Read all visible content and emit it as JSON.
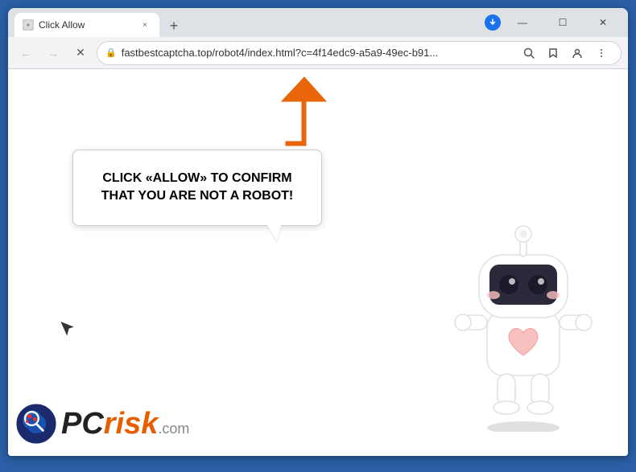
{
  "browser": {
    "title": "Click Allow",
    "tab": {
      "title": "Click Allow",
      "close_label": "×"
    },
    "new_tab_label": "+",
    "window_controls": {
      "minimize": "—",
      "maximize": "☐",
      "close": "✕"
    },
    "address_bar": {
      "url": "fastbestcaptcha.top/robot4/index.html?c=4f14edc9-a5a9-49ec-b91...",
      "lock_icon": "🔒",
      "back_label": "←",
      "forward_label": "→",
      "reload_label": "✕"
    }
  },
  "page": {
    "message": "CLICK «ALLOW» TO CONFIRM THAT YOU ARE NOT A ROBOT!",
    "arrow_direction": "up-right"
  },
  "pcrisk": {
    "pc_text": "PC",
    "risk_text": "risk",
    "domain": ".com"
  }
}
